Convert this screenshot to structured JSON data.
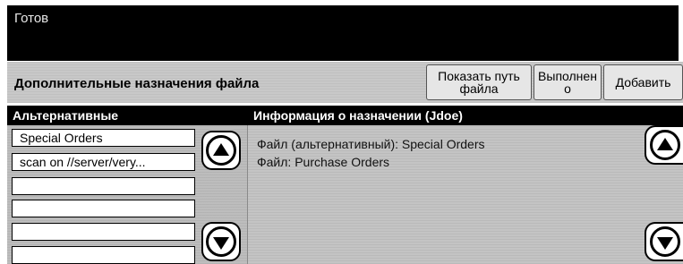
{
  "status": {
    "text": "Готов"
  },
  "header": {
    "title": "Дополнительные назначения файла",
    "buttons": {
      "show_path": [
        "Показать путь",
        "файла"
      ],
      "execute": [
        "Выполнен",
        "о"
      ],
      "add": "Добавить"
    }
  },
  "left_panel": {
    "header": "Альтернативные",
    "items": [
      "Special Orders",
      "scan on //server/very...",
      "",
      "",
      "",
      ""
    ]
  },
  "right_panel": {
    "header": "Информация о назначении (Jdoe)",
    "lines": [
      "Файл (альтернативный): Special Orders",
      "Файл: Purchase Orders"
    ]
  },
  "icons": {
    "scroll_up": "arrow-up-icon",
    "scroll_down": "arrow-down-icon"
  },
  "colors": {
    "status_bg": "#000000",
    "header_bg": "#c8c8c8",
    "panel_bg": "#c4c4c4",
    "column_header_bg": "#000000"
  }
}
